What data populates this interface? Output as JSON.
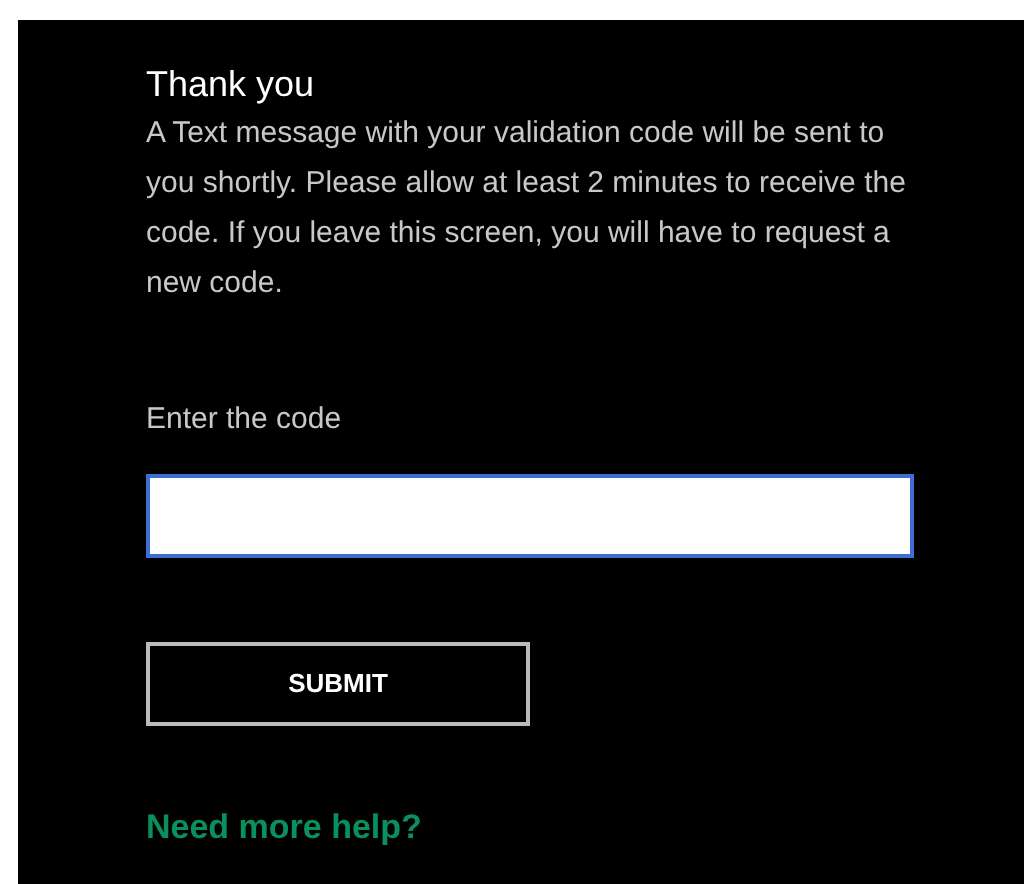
{
  "title": "Thank you",
  "message": "A Text message with your validation code will be sent to you shortly. Please allow at least 2 minutes to receive the code. If you leave this screen, you will have to request a new code.",
  "code_field": {
    "label": "Enter the code",
    "focused": true
  },
  "submit_button": "SUBMIT",
  "help_link": "Need more help?"
}
